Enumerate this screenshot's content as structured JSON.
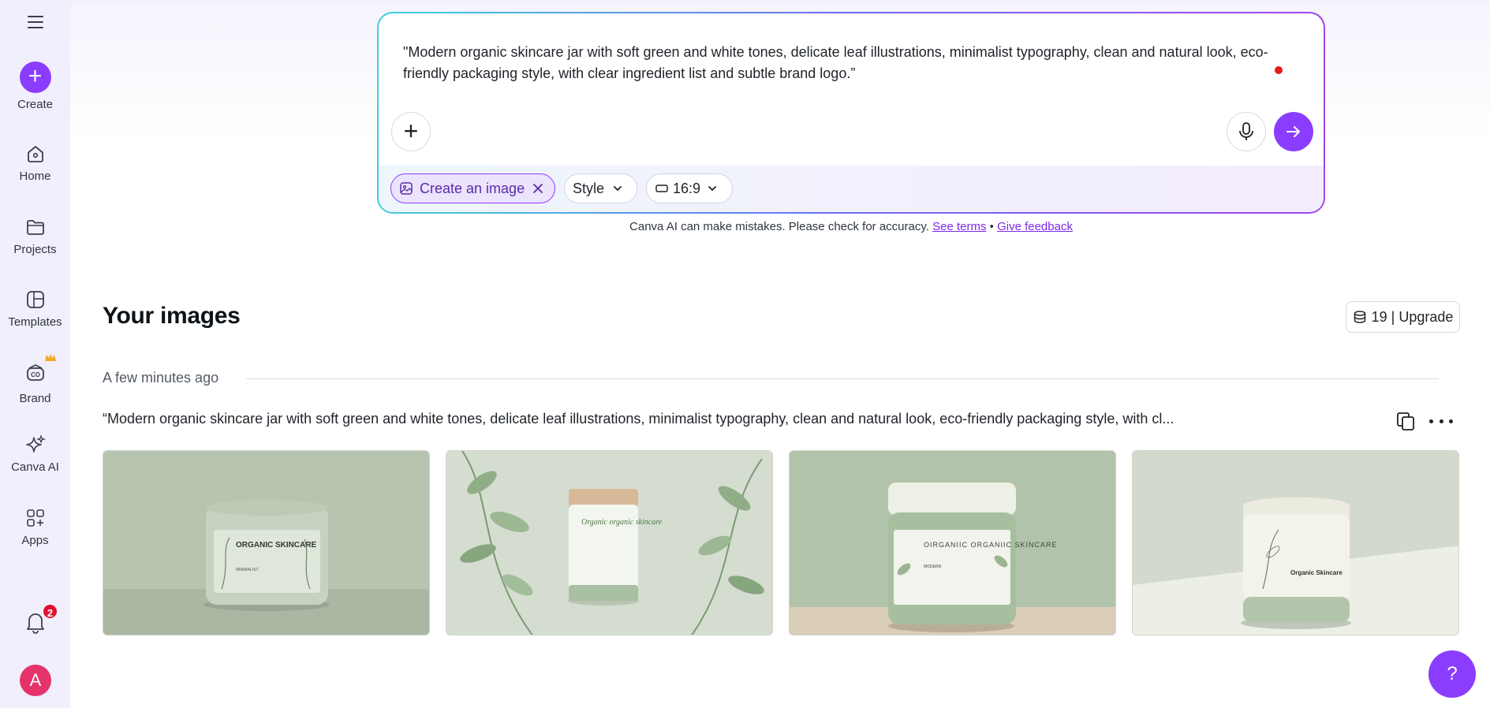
{
  "sidebar": {
    "create_label": "Create",
    "items": [
      {
        "label": "Home",
        "icon": "home-icon"
      },
      {
        "label": "Projects",
        "icon": "folder-icon"
      },
      {
        "label": "Templates",
        "icon": "templates-icon"
      },
      {
        "label": "Brand",
        "icon": "brand-icon"
      },
      {
        "label": "Canva AI",
        "icon": "sparkle-icon"
      },
      {
        "label": "Apps",
        "icon": "apps-icon"
      }
    ],
    "notifications_count": "2",
    "avatar_initial": "A"
  },
  "prompt": {
    "text": "\"Modern organic skincare jar with soft green and white tones, delicate leaf illustrations, minimalist typography, clean and natural look, eco-friendly packaging style, with clear ingredient list and subtle brand logo.”",
    "chips": {
      "create_image": "Create an image",
      "style": "Style",
      "ratio": "16:9"
    }
  },
  "disclaimer": {
    "text": "Canva AI can make mistakes. Please check for accuracy.",
    "see_terms": "See terms",
    "separator": "•",
    "give_feedback": "Give feedback"
  },
  "images_section": {
    "title": "Your images",
    "credits": "19 | Upgrade",
    "time_label": "A few minutes ago",
    "prompt_summary": "“Modern organic skincare jar with soft green and white tones, delicate leaf illustrations, minimalist typography, clean and natural look, eco-friendly packaging style, with cl...",
    "images": [
      {
        "jar_title": "ORGANIC SKINCARE",
        "jar_sub": "MINIMALIST"
      },
      {
        "jar_title": "Organic organic skincare",
        "jar_sub": ""
      },
      {
        "jar_title": "OIRGANIIC ORGANIIC SKINCARE",
        "jar_sub": "MODERN"
      },
      {
        "jar_title": "Organic Skincare",
        "jar_sub": ""
      }
    ]
  },
  "help_label": "?",
  "colors": {
    "accent": "#8b3dff",
    "badge": "#e0102f",
    "avatar": "#e5336b",
    "link": "#7d2ae8"
  }
}
